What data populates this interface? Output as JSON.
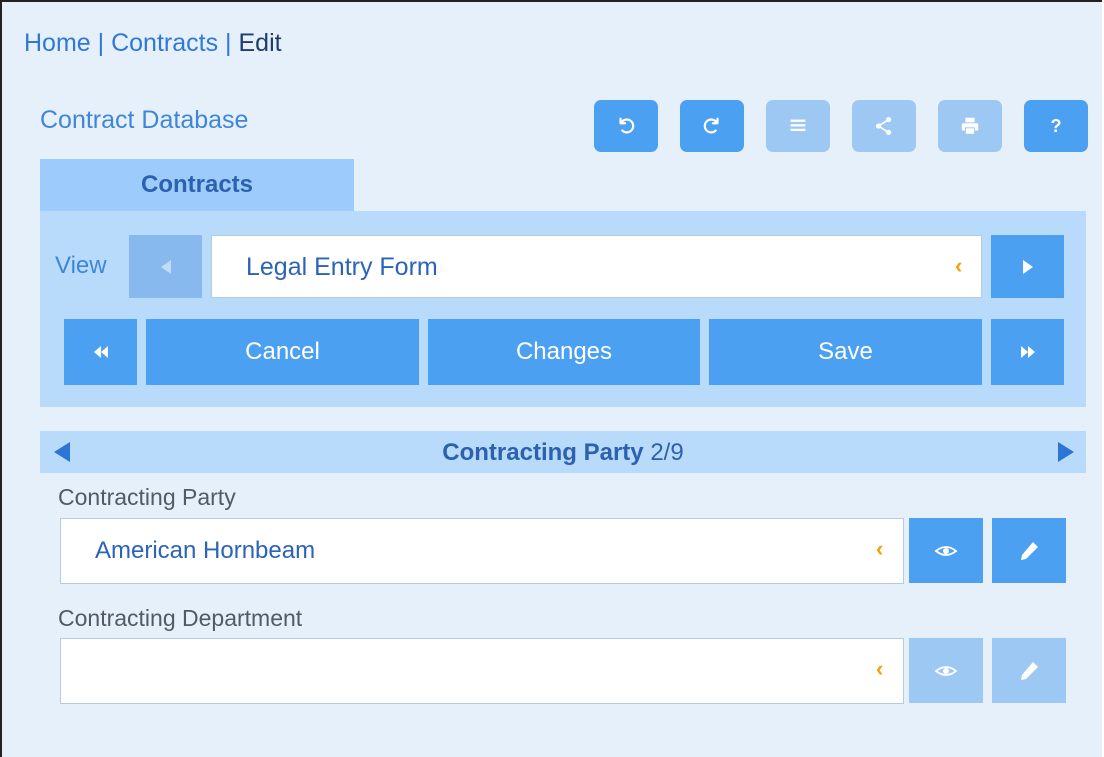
{
  "breadcrumb": {
    "home": "Home",
    "sep1": "|",
    "contracts": "Contracts",
    "sep2": "|",
    "current": "Edit"
  },
  "app_title": "Contract Database",
  "toolbar": {
    "buttons": [
      {
        "icon": "undo-icon",
        "enabled": true
      },
      {
        "icon": "redo-icon",
        "enabled": true
      },
      {
        "icon": "list-icon",
        "enabled": false
      },
      {
        "icon": "share-icon",
        "enabled": false
      },
      {
        "icon": "print-icon",
        "enabled": false
      },
      {
        "icon": "help-icon",
        "label": "?",
        "enabled": true
      }
    ]
  },
  "tabs": [
    {
      "label": "Contracts",
      "active": true
    }
  ],
  "view": {
    "label": "View",
    "selected": "Legal Entry Form",
    "prev_enabled": false,
    "next_enabled": true
  },
  "actions": {
    "cancel": "Cancel",
    "changes": "Changes",
    "save": "Save"
  },
  "section": {
    "title": "Contracting Party",
    "position": "2/9"
  },
  "fields": [
    {
      "label": "Contracting Party",
      "value": "American Hornbeam",
      "buttons_enabled": true
    },
    {
      "label": "Contracting Department",
      "value": "",
      "buttons_enabled": false
    }
  ],
  "colors": {
    "accent": "#4ca0f2",
    "accent_disabled": "#9cc8f3",
    "panel": "#b9dbfb",
    "background": "#e6f0fb",
    "dropdown_indicator": "#f2a20c"
  }
}
